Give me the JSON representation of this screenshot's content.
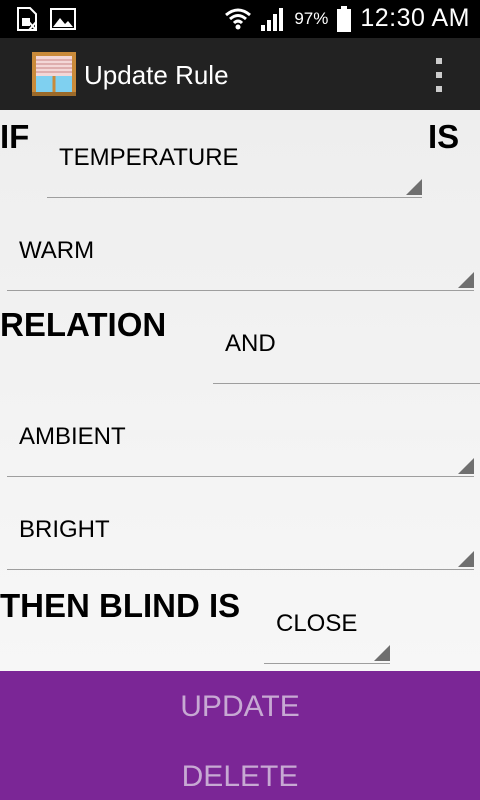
{
  "status_bar": {
    "battery_pct": "97%",
    "time": "12:30 AM",
    "icons": [
      "sim-card-icon",
      "image-icon",
      "wifi-icon",
      "signal-icon",
      "battery-icon"
    ]
  },
  "action_bar": {
    "title": "Update Rule",
    "icons": [
      "blind-window-app-icon",
      "overflow-menu-icon"
    ]
  },
  "form": {
    "if_label": "IF",
    "is_label": "IS",
    "sensor_value": "TEMPERATURE",
    "state_value": "WARM",
    "relation_label": "RELATION",
    "relation_value": "AND",
    "sensor2_value": "AMBIENT",
    "state2_value": "BRIGHT",
    "then_label": "THEN BLIND IS",
    "action_value": "CLOSE"
  },
  "buttons": {
    "update_label": "UPDATE",
    "delete_label": "DELETE"
  },
  "colors": {
    "status_bar_bg": "#000000",
    "action_bar_bg": "#222222",
    "button_bg": "#7b2696",
    "button_text": "#c7a9d3"
  }
}
